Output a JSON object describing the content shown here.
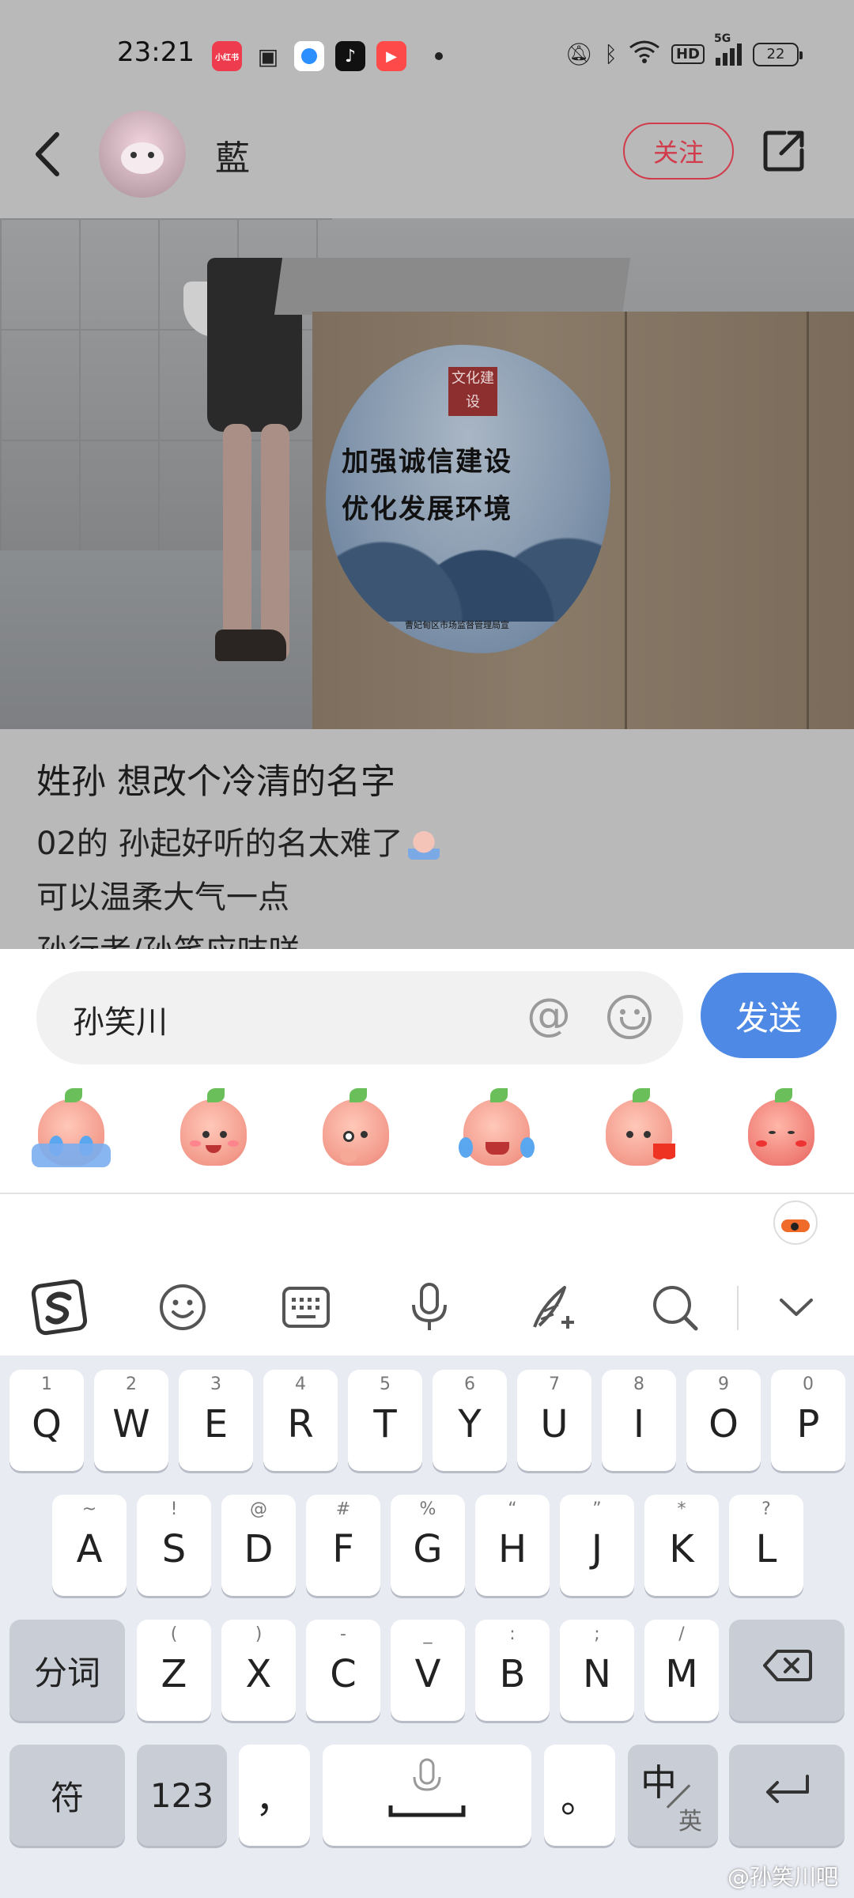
{
  "status_bar": {
    "time": "23:21",
    "app_icons": [
      {
        "name": "xiaohongshu-icon",
        "label": "小红书",
        "color": "#ef3b4e"
      },
      {
        "name": "bilibili-icon",
        "label": "",
        "color": "#ffffff"
      },
      {
        "name": "circle-app-icon",
        "label": "",
        "color": "#2b8fff"
      },
      {
        "name": "tiktok-icon",
        "label": "",
        "color": "#111111"
      },
      {
        "name": "video-app-icon",
        "label": "",
        "color": "#ff4a4a"
      }
    ],
    "network": "5G",
    "hd": "HD",
    "battery": "22"
  },
  "header": {
    "username": "藍",
    "follow_label": "关注"
  },
  "photo": {
    "poster_seal": "文化建设",
    "poster_line1": "加强诚信建设",
    "poster_line2": "优化发展环境",
    "poster_footer": "曹妃甸区市场监督管理局宣"
  },
  "post": {
    "title": "姓孙 想改个冷清的名字",
    "lines": [
      "02的 孙起好听的名太难了",
      "可以温柔大气一点",
      "孙行者/孙笑应吱咩"
    ]
  },
  "composer": {
    "input_value": "孙笑川",
    "send_label": "发送",
    "emojis": [
      "peach-crying-icon",
      "peach-smile-icon",
      "peach-thinking-icon",
      "peach-laugh-tears-icon",
      "peach-kiss-heart-icon",
      "peach-shy-icon"
    ]
  },
  "ime_toolbar": {
    "icons": [
      "sogou-logo-icon",
      "emoji-icon",
      "keyboard-icon",
      "microphone-icon",
      "handwriting-icon",
      "search-icon",
      "collapse-chevron-icon"
    ]
  },
  "keyboard": {
    "row1": [
      {
        "key": "Q",
        "hint": "1"
      },
      {
        "key": "W",
        "hint": "2"
      },
      {
        "key": "E",
        "hint": "3"
      },
      {
        "key": "R",
        "hint": "4"
      },
      {
        "key": "T",
        "hint": "5"
      },
      {
        "key": "Y",
        "hint": "6"
      },
      {
        "key": "U",
        "hint": "7"
      },
      {
        "key": "I",
        "hint": "8"
      },
      {
        "key": "O",
        "hint": "9"
      },
      {
        "key": "P",
        "hint": "0"
      }
    ],
    "row2": [
      {
        "key": "A",
        "hint": "~"
      },
      {
        "key": "S",
        "hint": "!"
      },
      {
        "key": "D",
        "hint": "@"
      },
      {
        "key": "F",
        "hint": "#"
      },
      {
        "key": "G",
        "hint": "%"
      },
      {
        "key": "H",
        "hint": "“"
      },
      {
        "key": "J",
        "hint": "”"
      },
      {
        "key": "K",
        "hint": "*"
      },
      {
        "key": "L",
        "hint": "?"
      }
    ],
    "row3": [
      {
        "key": "Z",
        "hint": "("
      },
      {
        "key": "X",
        "hint": ")"
      },
      {
        "key": "C",
        "hint": "-"
      },
      {
        "key": "V",
        "hint": "_"
      },
      {
        "key": "B",
        "hint": ":"
      },
      {
        "key": "N",
        "hint": ";"
      },
      {
        "key": "M",
        "hint": "/"
      }
    ],
    "fenci": "分词",
    "fu": "符",
    "num": "123",
    "comma": "，",
    "period": "。",
    "lang_main": "中",
    "lang_sub": "英"
  },
  "watermark": "@孙笑川吧"
}
